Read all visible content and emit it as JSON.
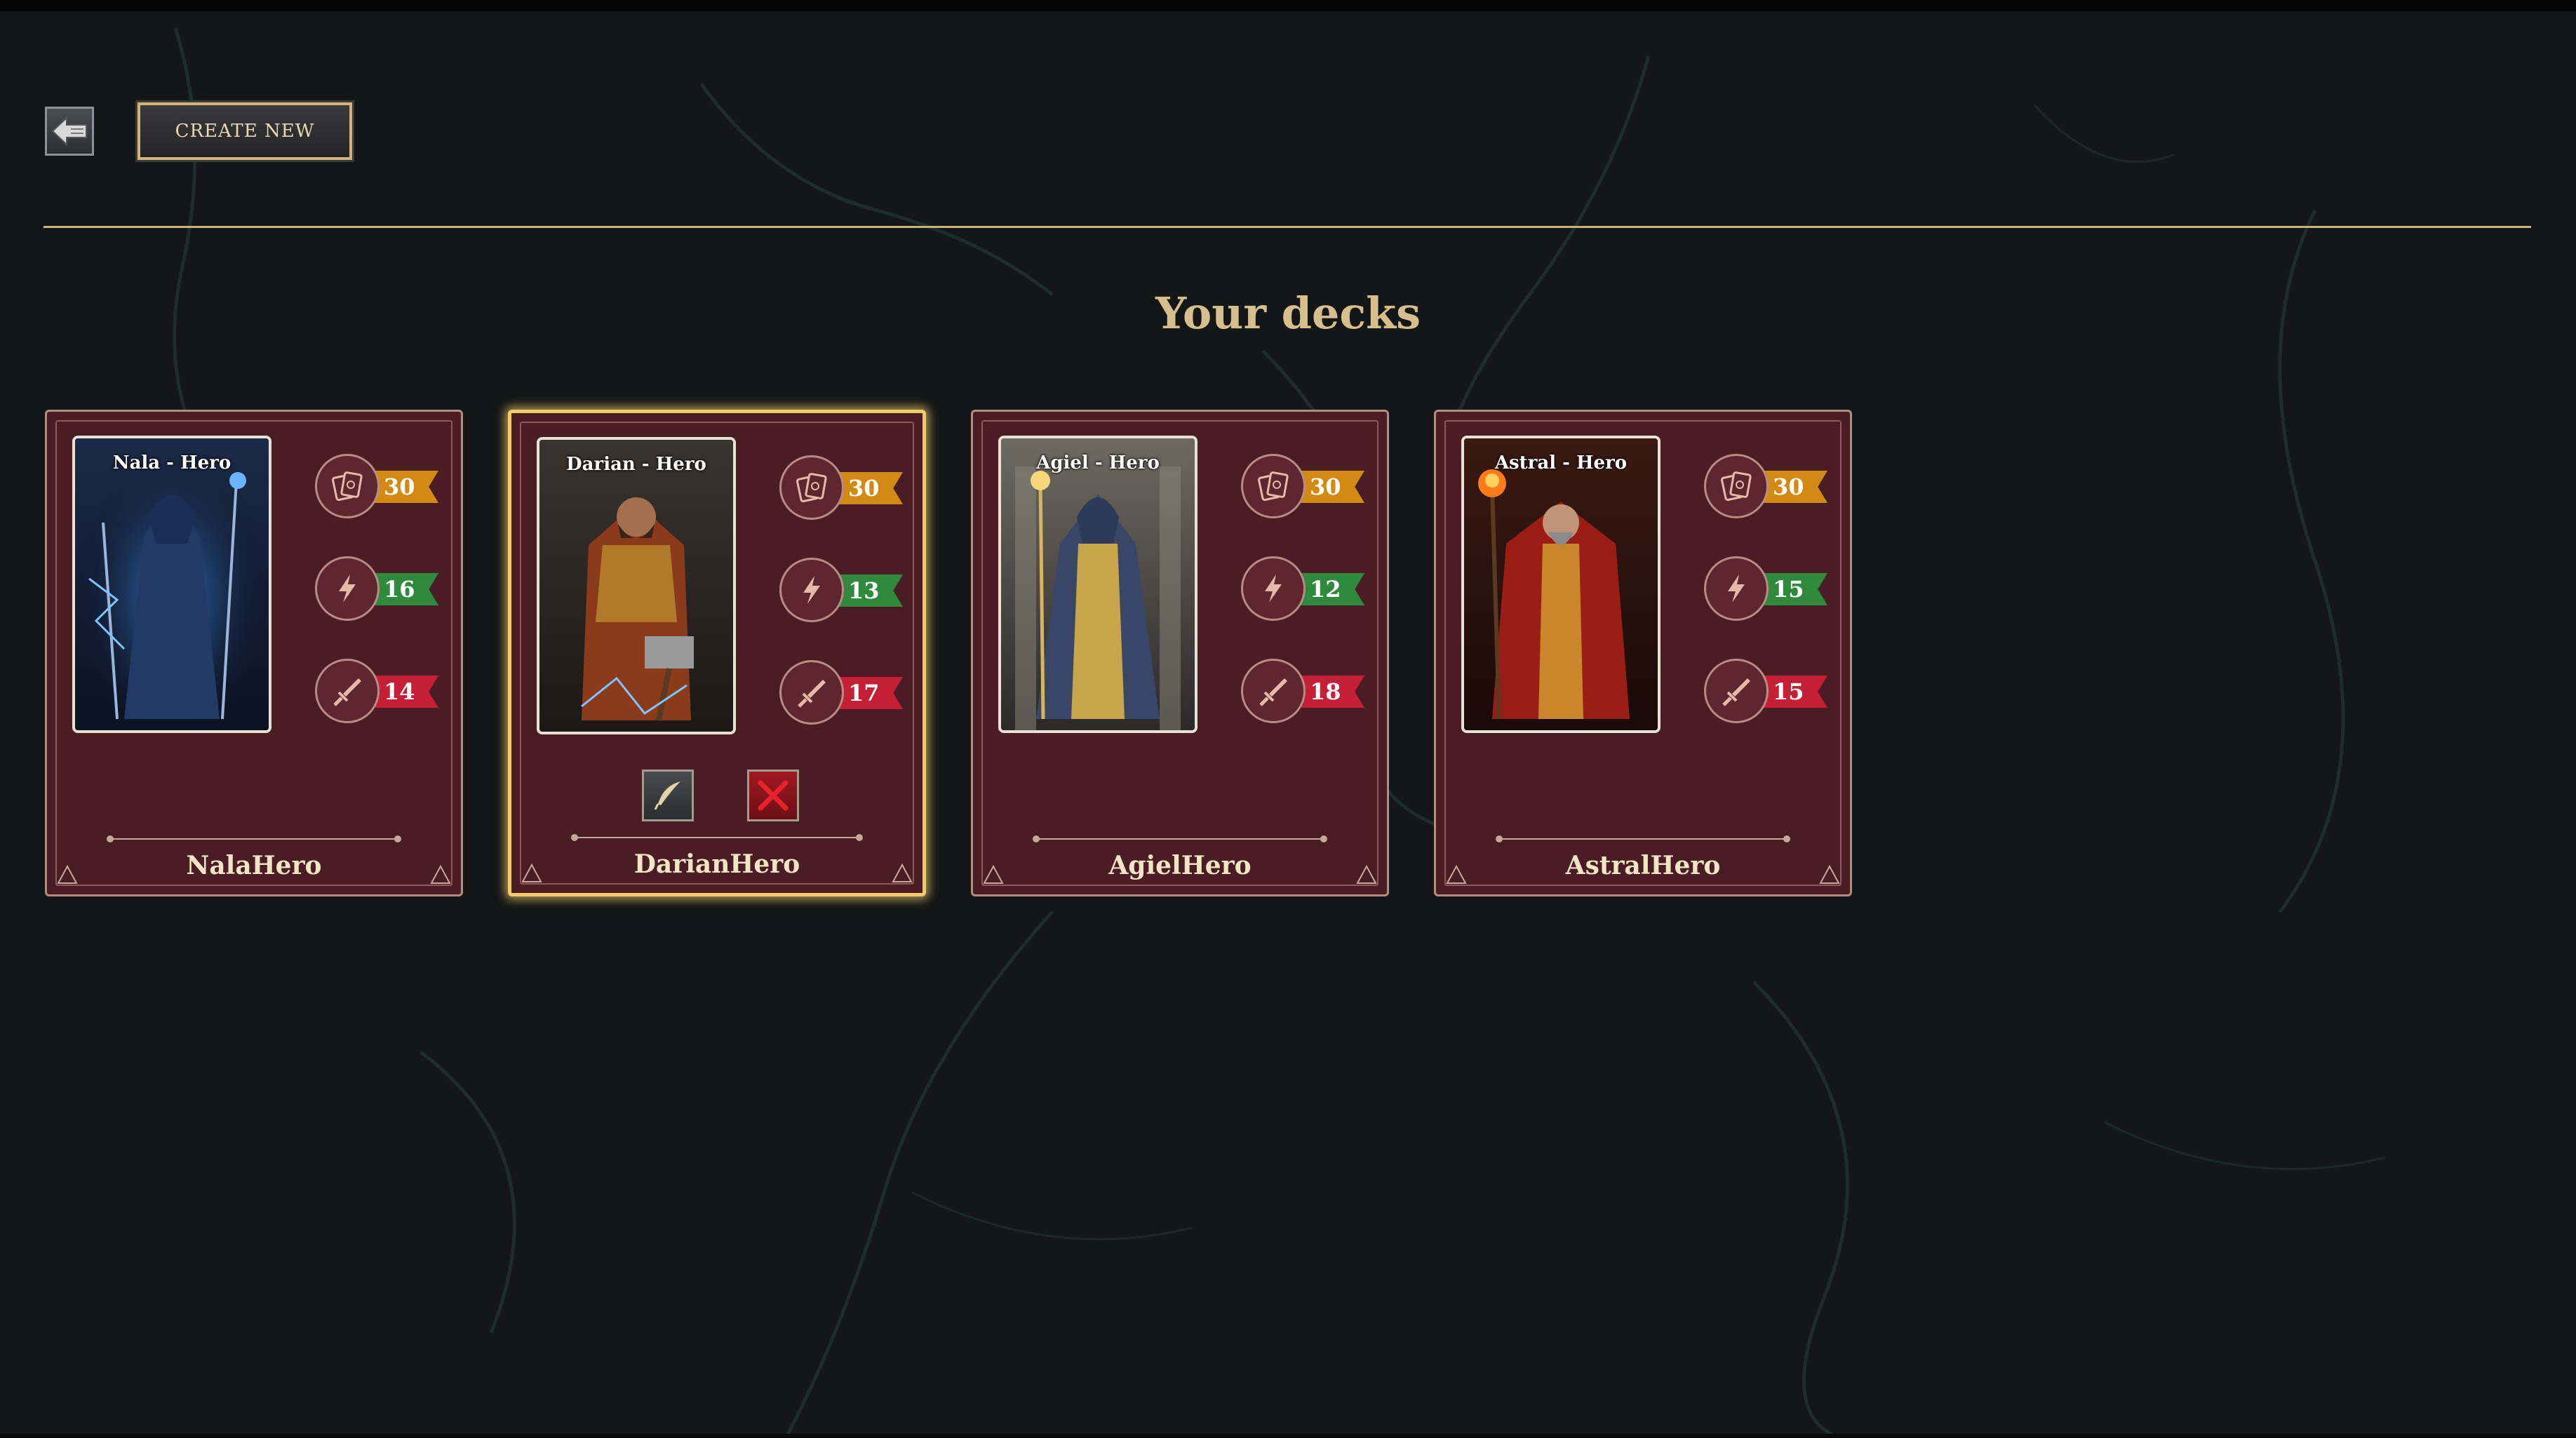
{
  "header": {
    "back_icon": "back-arrow-icon",
    "create_label": "CREATE NEW"
  },
  "section": {
    "title": "Your decks"
  },
  "colors": {
    "background": "#141617",
    "card": "#4a1c23",
    "accent_gold": "#d6bf8c",
    "cards_ribbon": "#d28a13",
    "energy_ribbon": "#2f8a3d",
    "attack_ribbon": "#c41f35",
    "selected_glow": "#f1cc67"
  },
  "decks": [
    {
      "name": "NalaHero",
      "hero_label": "Nala - Hero",
      "stats": {
        "cards": "30",
        "energy": "16",
        "attack": "14"
      },
      "selected": false
    },
    {
      "name": "DarianHero",
      "hero_label": "Darian - Hero",
      "stats": {
        "cards": "30",
        "energy": "13",
        "attack": "17"
      },
      "selected": true,
      "actions": {
        "edit_icon": "quill-icon",
        "delete_icon": "close-x-icon"
      }
    },
    {
      "name": "AgielHero",
      "hero_label": "Agiel - Hero",
      "stats": {
        "cards": "30",
        "energy": "12",
        "attack": "18"
      },
      "selected": false
    },
    {
      "name": "AstralHero",
      "hero_label": "Astral - Hero",
      "stats": {
        "cards": "30",
        "energy": "15",
        "attack": "15"
      },
      "selected": false
    }
  ]
}
